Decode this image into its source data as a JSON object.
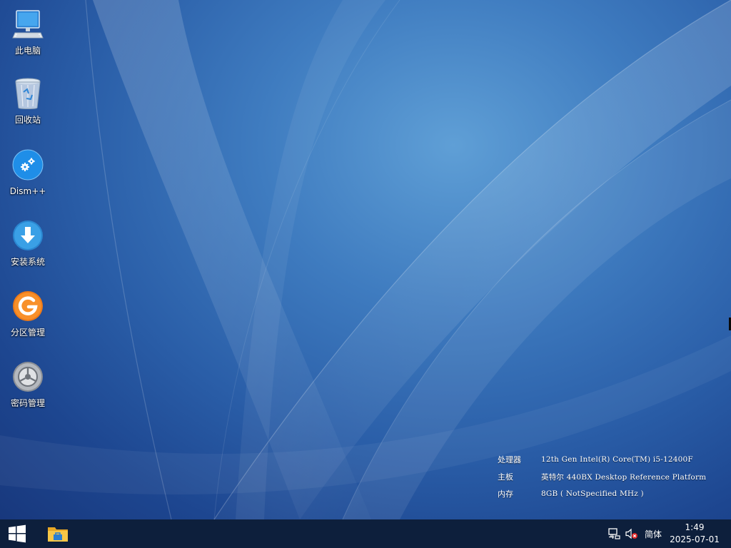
{
  "desktop": {
    "icons": [
      {
        "label": "此电脑",
        "icon": "computer-icon"
      },
      {
        "label": "回收站",
        "icon": "recycle-bin-icon"
      },
      {
        "label": "Dism++",
        "icon": "gears-icon"
      },
      {
        "label": "安装系统",
        "icon": "download-arrow-icon"
      },
      {
        "label": "分区管理",
        "icon": "partition-g-icon"
      },
      {
        "label": "密码管理",
        "icon": "lock-dial-icon"
      }
    ]
  },
  "sysinfo": {
    "rows": [
      {
        "key": "处理器",
        "value": "12th Gen Intel(R) Core(TM) i5-12400F"
      },
      {
        "key": "主板",
        "value": "英特尔 440BX Desktop Reference Platform"
      },
      {
        "key": "内存",
        "value": "8GB ( NotSpecified  MHz )"
      }
    ]
  },
  "taskbar": {
    "start_icon": "windows-logo-icon",
    "pinned": [
      {
        "icon": "file-explorer-icon"
      }
    ],
    "tray": {
      "network_icon": "network-disconnected-icon",
      "volume_icon": "volume-muted-icon",
      "ime": "简体",
      "time": "1:49",
      "date": "2025-07-01"
    }
  },
  "colors": {
    "taskbar_bg": "#0d1f3c",
    "wallpaper_light": "#5f9fd6",
    "wallpaper_dark": "#18387d"
  }
}
